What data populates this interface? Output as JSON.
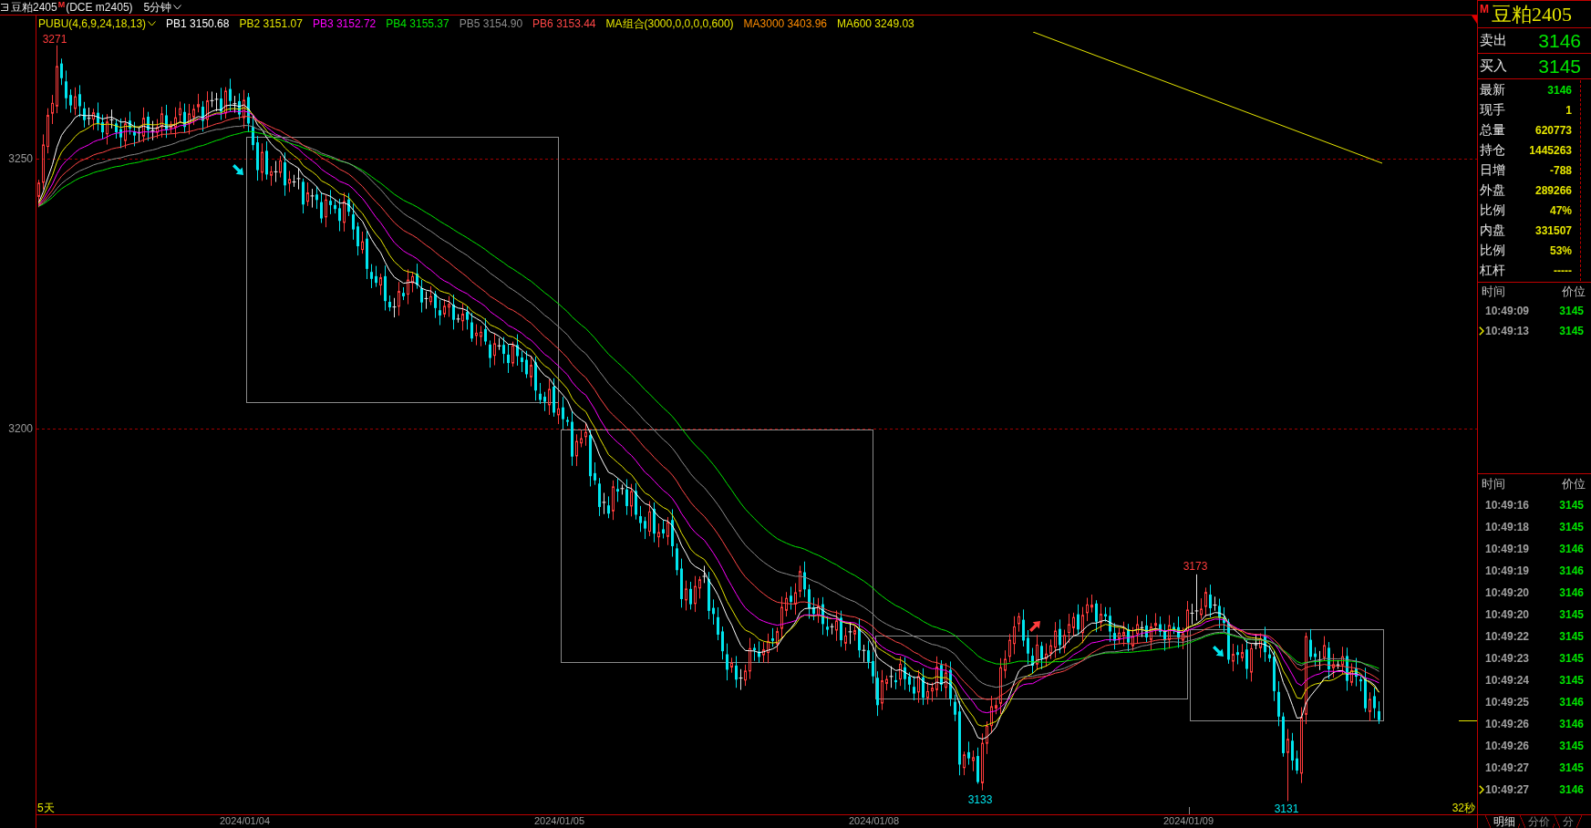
{
  "toolbar": {
    "symbol": "豆粕2405",
    "badge": "M",
    "exchange": "(DCE m2405)",
    "period": "5分钟"
  },
  "legend": [
    {
      "label": "PUBU(4,6,9,24,18,13)",
      "kind": "menu",
      "color": "#e6e600"
    },
    {
      "label": "PB1 3150.68",
      "kind": "line",
      "color": "#ffffff"
    },
    {
      "label": "PB2 3151.07",
      "kind": "line",
      "color": "#e6e600"
    },
    {
      "label": "PB3 3152.72",
      "kind": "line",
      "color": "#ff00ff"
    },
    {
      "label": "PB4 3155.37",
      "kind": "line",
      "color": "#00e600"
    },
    {
      "label": "PB5 3154.90",
      "kind": "line",
      "color": "#8c8c8c"
    },
    {
      "label": "PB6 3153.44",
      "kind": "line",
      "color": "#ff4646"
    },
    {
      "label": "MA组合(3000,0,0,0,0,600)",
      "kind": "text",
      "color": "#e6e600"
    },
    {
      "label": "MA3000 3403.96",
      "kind": "text",
      "color": "#ff8c00"
    },
    {
      "label": "MA600 3249.03",
      "kind": "ma",
      "color": "#e6e600"
    }
  ],
  "chart": {
    "price_ticks": [
      "3250",
      "3200"
    ],
    "extremes": [
      {
        "text": "3271",
        "kind": "high"
      },
      {
        "text": "3173",
        "kind": "high"
      },
      {
        "text": "3133",
        "kind": "low"
      },
      {
        "text": "3131",
        "kind": "low"
      }
    ],
    "range_label": "5天",
    "countdown": "32秒",
    "dates": [
      "2024/01/04",
      "2024/01/05",
      "2024/01/08",
      "2024/01/09"
    ]
  },
  "quote": {
    "badge": "M",
    "name": "豆粕2405",
    "ask": {
      "label": "卖出",
      "value": "3146"
    },
    "bid": {
      "label": "买入",
      "value": "3145"
    },
    "stats": [
      {
        "label": "最新",
        "value": "3146",
        "kind": "price"
      },
      {
        "label": "现手",
        "value": "1",
        "kind": "figure"
      },
      {
        "label": "总量",
        "value": "620773",
        "kind": "figure"
      },
      {
        "label": "持仓",
        "value": "1445263",
        "kind": "figure"
      },
      {
        "label": "日增",
        "value": "-788",
        "kind": "figure"
      },
      {
        "label": "外盘",
        "value": "289266",
        "kind": "figure"
      },
      {
        "label": "比例",
        "value": "47%",
        "kind": "figure"
      },
      {
        "label": "内盘",
        "value": "331507",
        "kind": "figure"
      },
      {
        "label": "比例",
        "value": "53%",
        "kind": "figure"
      },
      {
        "label": "杠杆",
        "value": "-----",
        "kind": "figure"
      }
    ]
  },
  "ticks_recent": {
    "columns": [
      "时间",
      "价位"
    ],
    "rows": [
      {
        "time": "10:49:09",
        "price": "3145",
        "marked": false
      },
      {
        "time": "10:49:13",
        "price": "3145",
        "marked": true
      }
    ]
  },
  "ticks": {
    "columns": [
      "时间",
      "价位"
    ],
    "rows": [
      {
        "time": "10:49:16",
        "price": "3145",
        "marked": false
      },
      {
        "time": "10:49:18",
        "price": "3145",
        "marked": false
      },
      {
        "time": "10:49:19",
        "price": "3146",
        "marked": false
      },
      {
        "time": "10:49:19",
        "price": "3146",
        "marked": false
      },
      {
        "time": "10:49:20",
        "price": "3146",
        "marked": false
      },
      {
        "time": "10:49:20",
        "price": "3145",
        "marked": false
      },
      {
        "time": "10:49:22",
        "price": "3145",
        "marked": false
      },
      {
        "time": "10:49:23",
        "price": "3145",
        "marked": false
      },
      {
        "time": "10:49:24",
        "price": "3145",
        "marked": false
      },
      {
        "time": "10:49:25",
        "price": "3146",
        "marked": false
      },
      {
        "time": "10:49:26",
        "price": "3146",
        "marked": false
      },
      {
        "time": "10:49:26",
        "price": "3145",
        "marked": false
      },
      {
        "time": "10:49:27",
        "price": "3145",
        "marked": false
      },
      {
        "time": "10:49:27",
        "price": "3146",
        "marked": true
      }
    ]
  },
  "tabs": [
    {
      "label": "明细",
      "selected": true
    },
    {
      "label": "分价",
      "selected": false
    },
    {
      "label": "分",
      "selected": false
    }
  ]
}
